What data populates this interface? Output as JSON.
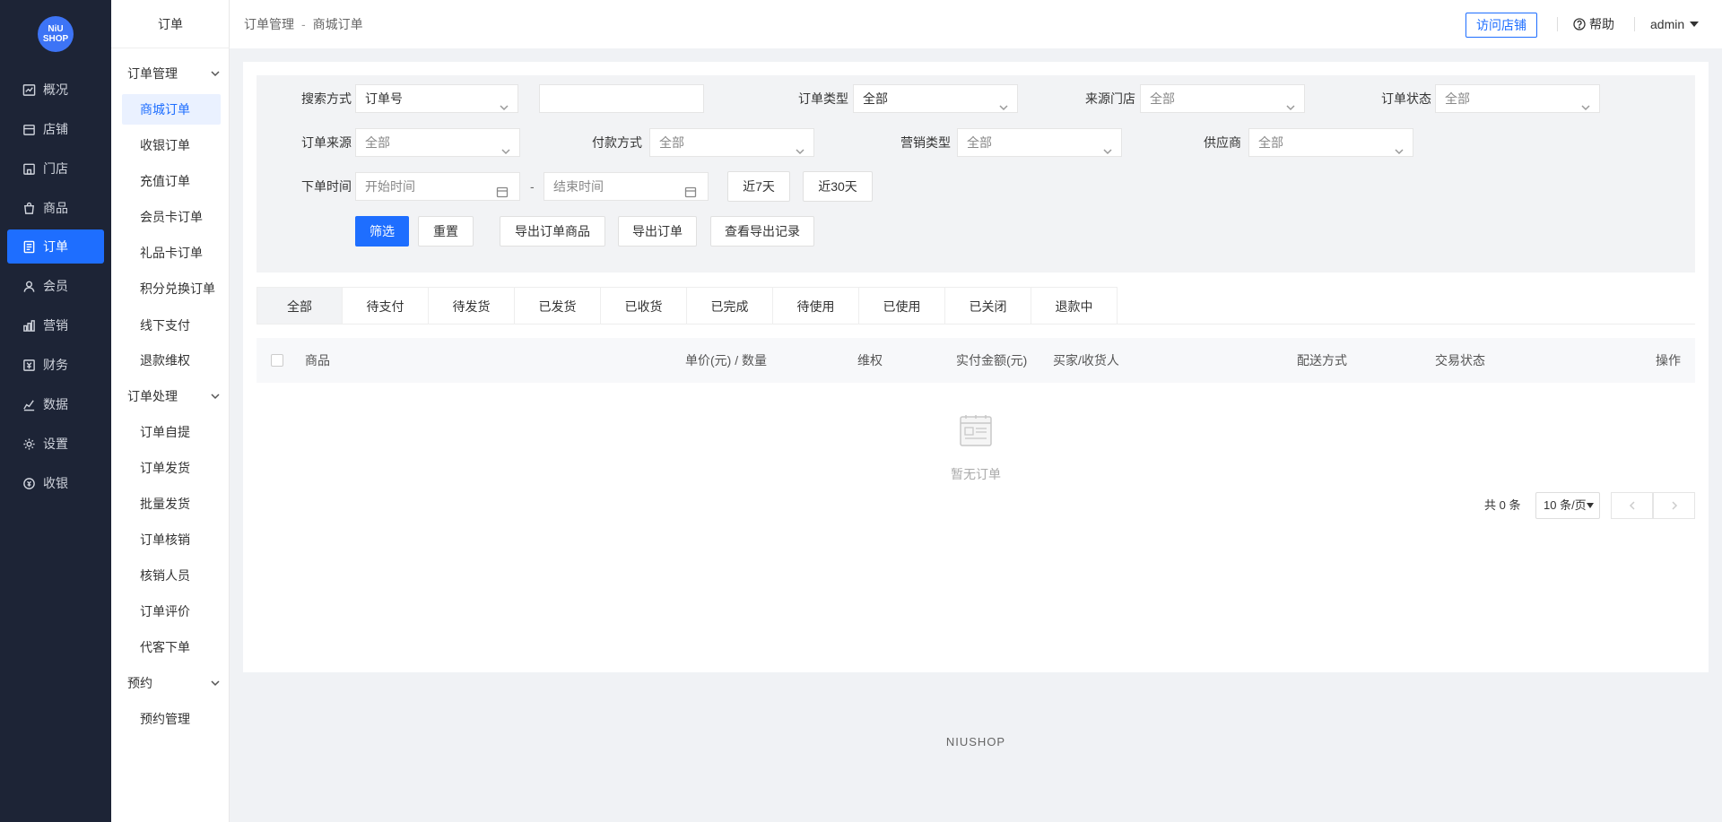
{
  "logo": {
    "line1": "NiU",
    "line2": "SHOP"
  },
  "nav": [
    {
      "label": "概况",
      "icon": "trend-icon"
    },
    {
      "label": "店铺",
      "icon": "store-icon"
    },
    {
      "label": "门店",
      "icon": "shop-icon"
    },
    {
      "label": "商品",
      "icon": "bag-icon"
    },
    {
      "label": "订单",
      "icon": "order-icon",
      "active": true
    },
    {
      "label": "会员",
      "icon": "user-icon"
    },
    {
      "label": "营销",
      "icon": "bars-icon"
    },
    {
      "label": "财务",
      "icon": "finance-icon"
    },
    {
      "label": "数据",
      "icon": "chart-icon"
    },
    {
      "label": "设置",
      "icon": "gear-icon"
    },
    {
      "label": "收银",
      "icon": "cashier-icon"
    }
  ],
  "subbar": {
    "title": "订单",
    "group1": "订单管理",
    "group1_items": [
      "商城订单",
      "收银订单",
      "充值订单",
      "会员卡订单",
      "礼品卡订单",
      "积分兑换订单",
      "线下支付",
      "退款维权"
    ],
    "group2": "订单处理",
    "group2_items": [
      "订单自提",
      "订单发货",
      "批量发货",
      "订单核销",
      "核销人员",
      "订单评价",
      "代客下单"
    ],
    "group3": "预约",
    "group3_items": [
      "预约管理"
    ]
  },
  "header": {
    "breadcrumb1": "订单管理",
    "sep": "-",
    "breadcrumb2": "商城订单",
    "visit": "访问店铺",
    "help": "帮助",
    "user": "admin"
  },
  "filters": {
    "search_label": "搜索方式",
    "search_value": "订单号",
    "order_type_label": "订单类型",
    "order_type_value": "全部",
    "store_label": "来源门店",
    "store_value": "全部",
    "status_label": "订单状态",
    "status_value": "全部",
    "source_label": "订单来源",
    "source_value": "全部",
    "pay_label": "付款方式",
    "pay_value": "全部",
    "marketing_label": "营销类型",
    "marketing_value": "全部",
    "supplier_label": "供应商",
    "supplier_value": "全部",
    "time_label": "下单时间",
    "start_placeholder": "开始时间",
    "end_placeholder": "结束时间",
    "dash": "-",
    "last7": "近7天",
    "last30": "近30天",
    "filter_btn": "筛选",
    "reset_btn": "重置",
    "export_goods_btn": "导出订单商品",
    "export_order_btn": "导出订单",
    "export_record_btn": "查看导出记录"
  },
  "tabs": [
    "全部",
    "待支付",
    "待发货",
    "已发货",
    "已收货",
    "已完成",
    "待使用",
    "已使用",
    "已关闭",
    "退款中"
  ],
  "table": {
    "columns": [
      "商品",
      "单价(元) / 数量",
      "维权",
      "实付金额(元)",
      "买家/收货人",
      "配送方式",
      "交易状态",
      "操作"
    ],
    "empty": "暂无订单"
  },
  "pager": {
    "total": "共 0 条",
    "size": "10 条/页"
  },
  "footer": "NIUSHOP"
}
